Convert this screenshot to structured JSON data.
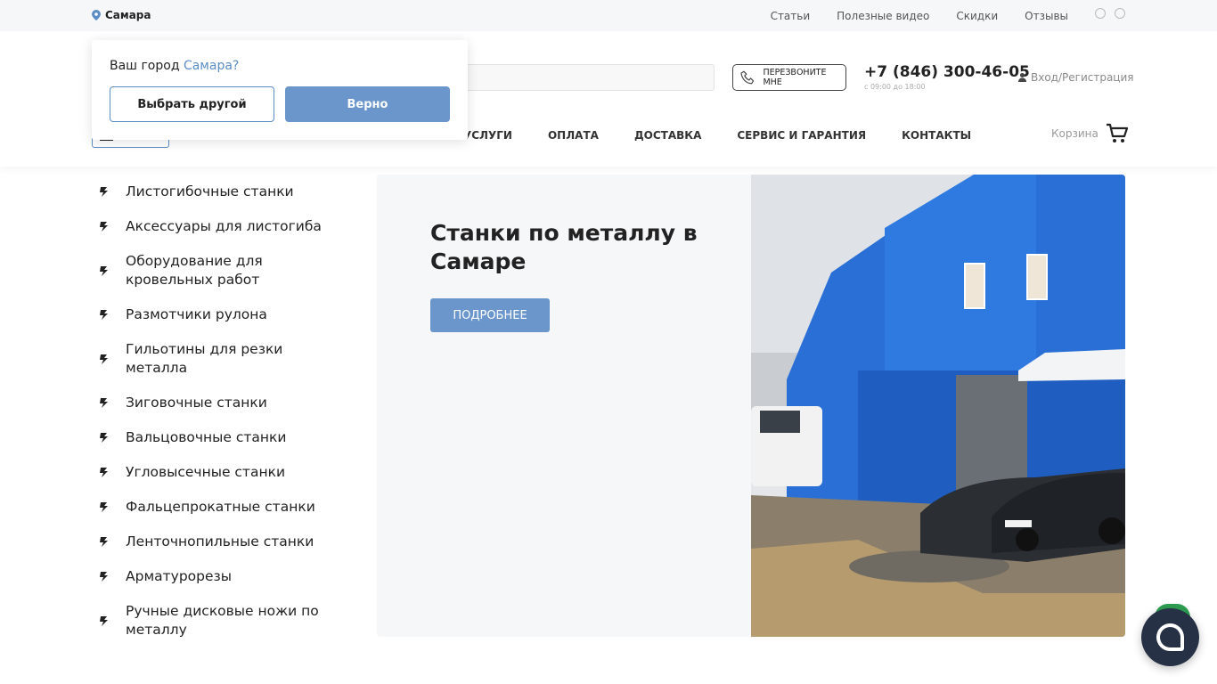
{
  "topbar": {
    "city": "Самара",
    "nav": [
      "Статьи",
      "Полезные видео",
      "Скидки",
      "Отзывы"
    ],
    "social_icons": [
      "telegram-icon",
      "whatsapp-icon"
    ]
  },
  "header": {
    "callback_label": "ПЕРЕЗВОНИТЕ МНЕ",
    "phone": "+7 (846) 300-46-05",
    "hours": "с 09:00 до 18:00",
    "login_label": "Вход/Регистрация",
    "nav": [
      "УСЛУГИ",
      "ОПЛАТА",
      "ДОСТАВКА",
      "СЕРВИС И ГАРАНТИЯ",
      "КОНТАКТЫ"
    ],
    "cart_label": "Корзина"
  },
  "city_popup": {
    "question": "Ваш город",
    "city": "Самара?",
    "choose_other_label": "Выбрать другой",
    "confirm_label": "Верно"
  },
  "catalog": {
    "items": [
      {
        "label": "Листогибочные станки"
      },
      {
        "label": "Аксессуары для листогиба"
      },
      {
        "label": "Оборудование для кровельных работ"
      },
      {
        "label": "Размотчики рулона"
      },
      {
        "label": "Гильотины для резки металла"
      },
      {
        "label": "Зиговочные станки"
      },
      {
        "label": "Вальцовочные станки"
      },
      {
        "label": "Угловысечные станки"
      },
      {
        "label": "Фальцепрокатные станки"
      },
      {
        "label": "Ленточнопильные станки"
      },
      {
        "label": "Арматурорезы"
      },
      {
        "label": "Ручные дисковые ножи по металлу"
      }
    ]
  },
  "hero": {
    "title": "Станки по металлу в Самаре",
    "button_label": "ПОДРОБНЕЕ"
  },
  "colors": {
    "accent": "#6a96cc",
    "chat": "#263145"
  }
}
